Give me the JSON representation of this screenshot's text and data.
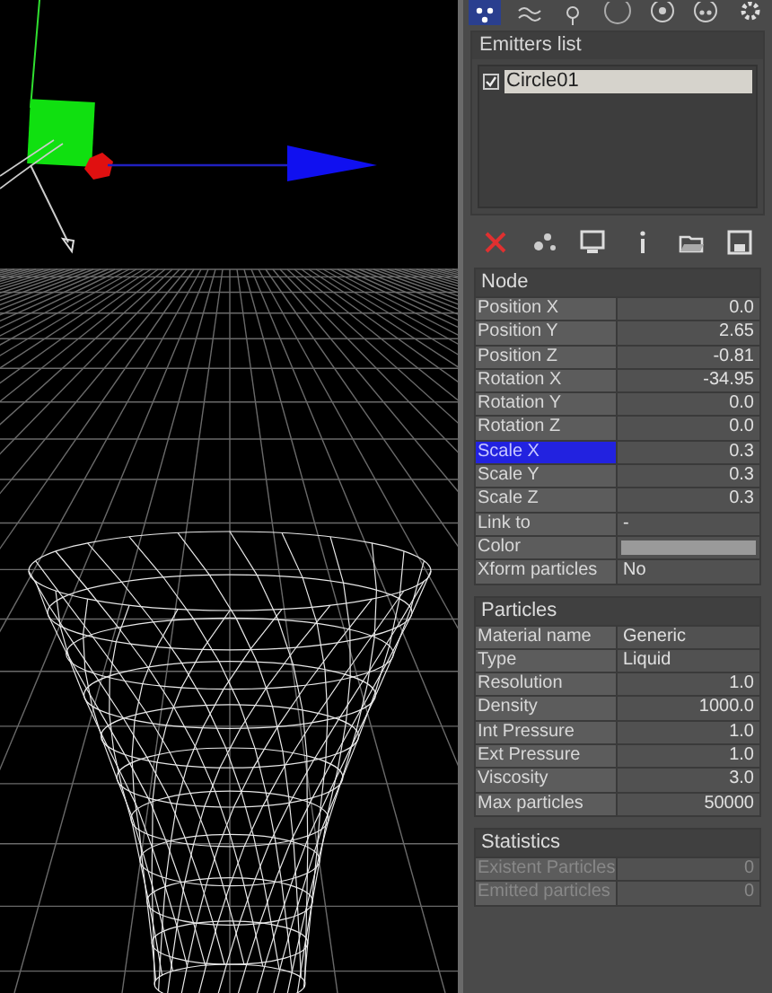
{
  "panel_tabs": [
    {
      "selected": true
    },
    {
      "selected": false
    },
    {
      "selected": false
    },
    {
      "selected": false
    },
    {
      "selected": false
    },
    {
      "selected": false
    },
    {
      "selected": false
    }
  ],
  "emitters_list": {
    "title": "Emitters list",
    "items": [
      {
        "label": "Circle01",
        "checked": true,
        "selected": true
      }
    ]
  },
  "sections": [
    {
      "title": "Node",
      "rows": [
        {
          "kind": "number",
          "label": "Position X",
          "value": "0.0",
          "selected": false
        },
        {
          "kind": "number",
          "label": "Position Y",
          "value": "2.65",
          "selected": false
        },
        {
          "kind": "number",
          "label": "Position Z",
          "value": "-0.81",
          "selected": false
        },
        {
          "kind": "number",
          "label": "Rotation X",
          "value": "-34.95",
          "selected": false
        },
        {
          "kind": "number",
          "label": "Rotation Y",
          "value": "0.0",
          "selected": false
        },
        {
          "kind": "number",
          "label": "Rotation Z",
          "value": "0.0",
          "selected": false
        },
        {
          "kind": "number",
          "label": "Scale X",
          "value": "0.3",
          "selected": true
        },
        {
          "kind": "number",
          "label": "Scale Y",
          "value": "0.3",
          "selected": false
        },
        {
          "kind": "number",
          "label": "Scale Z",
          "value": "0.3",
          "selected": false
        },
        {
          "kind": "text",
          "label": "Link to",
          "value": "-",
          "selected": false
        },
        {
          "kind": "swatch",
          "label": "Color",
          "color": "#9a9a9a",
          "selected": false
        },
        {
          "kind": "text",
          "label": "Xform particles",
          "value": "No",
          "selected": false
        }
      ]
    },
    {
      "title": "Particles",
      "rows": [
        {
          "kind": "text",
          "label": "Material name",
          "value": "Generic",
          "selected": false
        },
        {
          "kind": "text",
          "label": "Type",
          "value": "Liquid",
          "selected": false
        },
        {
          "kind": "number",
          "label": "Resolution",
          "value": "1.0",
          "selected": false
        },
        {
          "kind": "number",
          "label": "Density",
          "value": "1000.0",
          "selected": false
        },
        {
          "kind": "number",
          "label": "Int Pressure",
          "value": "1.0",
          "selected": false
        },
        {
          "kind": "number",
          "label": "Ext Pressure",
          "value": "1.0",
          "selected": false
        },
        {
          "kind": "number",
          "label": "Viscosity",
          "value": "3.0",
          "selected": false
        },
        {
          "kind": "number",
          "label": "Max particles",
          "value": "50000",
          "selected": false
        }
      ]
    },
    {
      "title": "Statistics",
      "rows": [
        {
          "kind": "number",
          "label": "Existent Particles",
          "value": "0",
          "selected": false,
          "disabled": true
        },
        {
          "kind": "number",
          "label": "Emitted particles",
          "value": "0",
          "selected": false,
          "disabled": true
        }
      ]
    }
  ]
}
